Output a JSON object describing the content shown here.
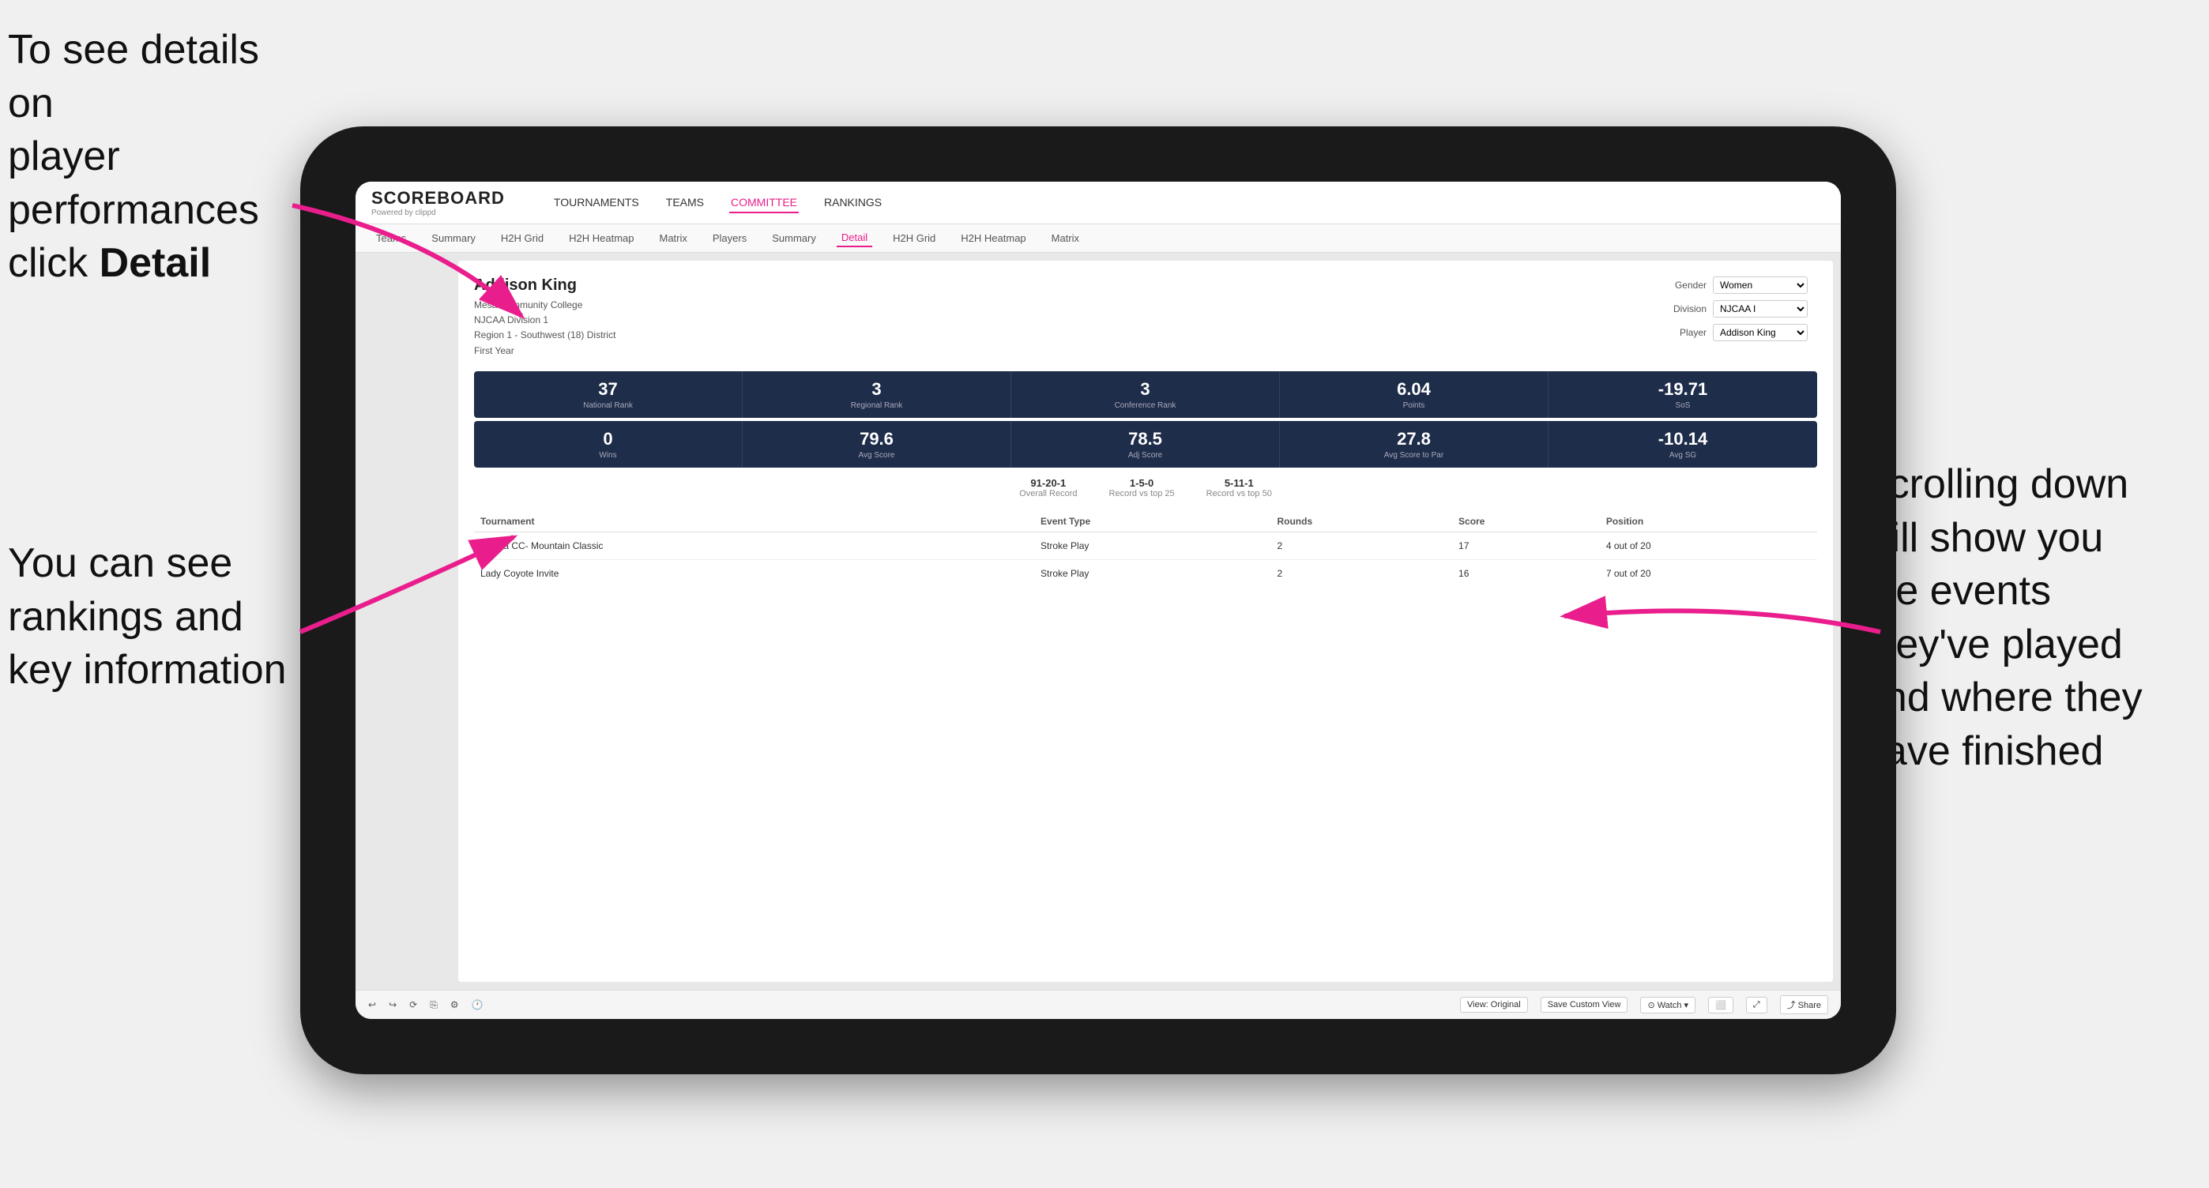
{
  "annotations": {
    "top_left_line1": "To see details on",
    "top_left_line2": "player performances",
    "top_left_line3": "click ",
    "top_left_bold": "Detail",
    "bottom_left_line1": "You can see",
    "bottom_left_line2": "rankings and",
    "bottom_left_line3": "key information",
    "right_line1": "Scrolling down",
    "right_line2": "will show you",
    "right_line3": "the events",
    "right_line4": "they've played",
    "right_line5": "and where they",
    "right_line6": "have finished"
  },
  "app": {
    "logo": "SCOREBOARD",
    "logo_sub": "Powered by clippd",
    "nav_items": [
      "TOURNAMENTS",
      "TEAMS",
      "COMMITTEE",
      "RANKINGS"
    ],
    "active_nav": "COMMITTEE",
    "sub_nav_items": [
      "Teams",
      "Summary",
      "H2H Grid",
      "H2H Heatmap",
      "Matrix",
      "Players",
      "Summary",
      "Detail",
      "H2H Grid",
      "H2H Heatmap",
      "Matrix"
    ],
    "active_sub_nav": "Detail"
  },
  "player": {
    "name": "Addison King",
    "college": "Mesa Community College",
    "division": "NJCAA Division 1",
    "region": "Region 1 - Southwest (18) District",
    "year": "First Year",
    "gender_label": "Gender",
    "gender_value": "Women",
    "division_label": "Division",
    "division_value": "NJCAA I",
    "player_label": "Player",
    "player_value": "Addison King"
  },
  "stats_row1": [
    {
      "value": "37",
      "label": "National Rank"
    },
    {
      "value": "3",
      "label": "Regional Rank"
    },
    {
      "value": "3",
      "label": "Conference Rank"
    },
    {
      "value": "6.04",
      "label": "Points"
    },
    {
      "value": "-19.71",
      "label": "SoS"
    }
  ],
  "stats_row2": [
    {
      "value": "0",
      "label": "Wins"
    },
    {
      "value": "79.6",
      "label": "Avg Score"
    },
    {
      "value": "78.5",
      "label": "Adj Score"
    },
    {
      "value": "27.8",
      "label": "Avg Score to Par"
    },
    {
      "value": "-10.14",
      "label": "Avg SG"
    }
  ],
  "records": [
    {
      "value": "91-20-1",
      "label": "Overall Record"
    },
    {
      "value": "1-5-0",
      "label": "Record vs top 25"
    },
    {
      "value": "5-11-1",
      "label": "Record vs top 50"
    }
  ],
  "table": {
    "headers": [
      "Tournament",
      "",
      "Event Type",
      "Rounds",
      "Score",
      "Position"
    ],
    "rows": [
      {
        "tournament": "Estella CC- Mountain Classic",
        "event_type": "Stroke Play",
        "rounds": "2",
        "score": "17",
        "position": "4 out of 20"
      },
      {
        "tournament": "Lady Coyote Invite",
        "event_type": "Stroke Play",
        "rounds": "2",
        "score": "16",
        "position": "7 out of 20"
      }
    ]
  },
  "toolbar": {
    "buttons": [
      "View: Original",
      "Save Custom View",
      "Watch ▾",
      "Share"
    ]
  }
}
